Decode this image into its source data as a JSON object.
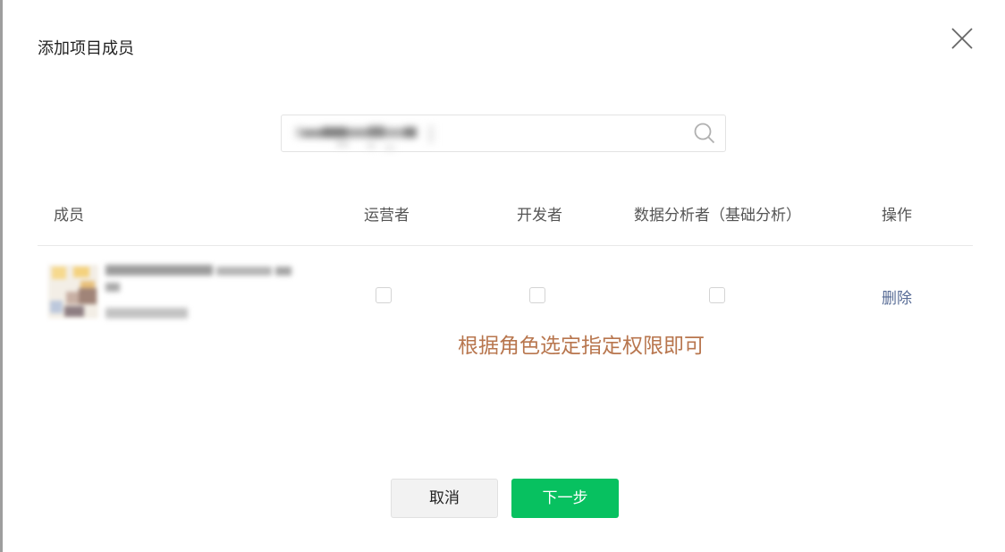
{
  "dialog": {
    "title": "添加项目成员"
  },
  "search": {
    "value": "",
    "placeholder": ""
  },
  "table": {
    "columns": [
      "成员",
      "运营者",
      "开发者",
      "数据分析者（基础分析）",
      "操作"
    ],
    "rows": [
      {
        "operator_checked": false,
        "developer_checked": false,
        "analyst_checked": false,
        "action_label": "删除"
      }
    ]
  },
  "annotation": {
    "text": "根据角色选定指定权限即可",
    "color": "#b8764e"
  },
  "footer": {
    "cancel_label": "取消",
    "next_label": "下一步"
  },
  "colors": {
    "primary": "#07c160",
    "link": "#576b95"
  },
  "icons": {
    "close": "close-icon",
    "search": "search-icon"
  }
}
